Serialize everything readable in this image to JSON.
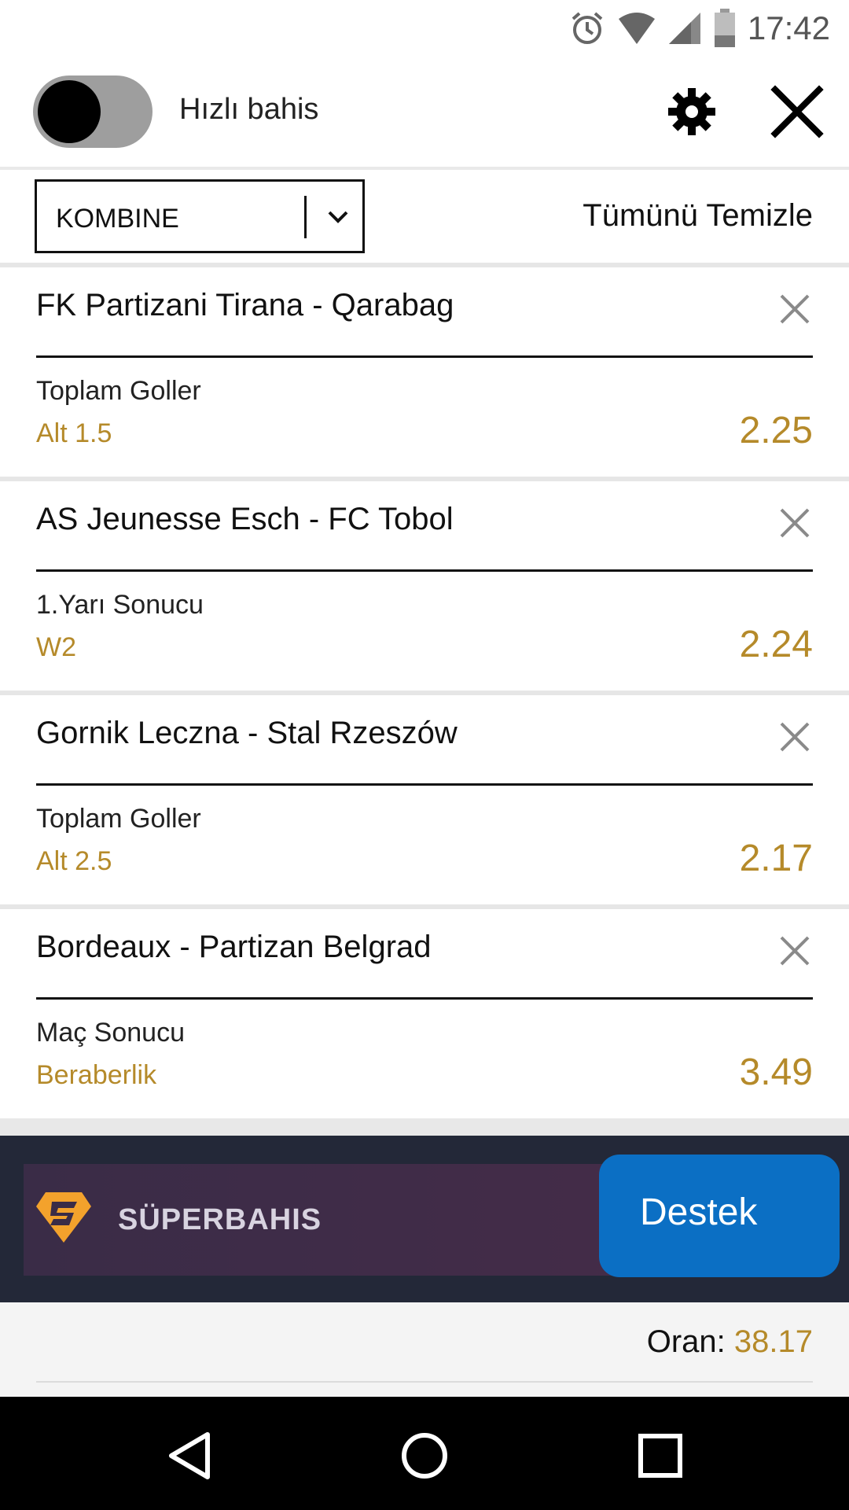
{
  "status_bar": {
    "time": "17:42",
    "icons": [
      "alarm-icon",
      "wifi-icon",
      "signal-icon",
      "battery-icon"
    ]
  },
  "header": {
    "quick_bet_label": "Hızlı bahis",
    "quick_bet_enabled": false,
    "icons": [
      "gear-icon",
      "close-icon"
    ]
  },
  "slip": {
    "type_value": "KOMBINE",
    "clear_all_label": "Tümünü Temizle"
  },
  "bets": [
    {
      "match": "FK Partizani Tirana - Qarabag",
      "market": "Toplam Goller",
      "pick": "Alt 1.5",
      "odds": "2.25"
    },
    {
      "match": "AS Jeunesse Esch - FC Tobol",
      "market": "1.Yarı Sonucu",
      "pick": "W2",
      "odds": "2.24"
    },
    {
      "match": "Gornik Leczna - Stal Rzeszów",
      "market": "Toplam Goller",
      "pick": "Alt 2.5",
      "odds": "2.17"
    },
    {
      "match": "Bordeaux - Partizan Belgrad",
      "market": "Maç Sonucu",
      "pick": "Beraberlik",
      "odds": "3.49"
    }
  ],
  "banner": {
    "brand": "SÜPERBAHIS",
    "support_label": "Destek"
  },
  "footer": {
    "odds_label": "Oran:",
    "odds_value": "38.17"
  },
  "colors": {
    "accent_gold": "#b58a2a",
    "support_blue": "#0b6fc4",
    "banner_dark": "#232838"
  }
}
